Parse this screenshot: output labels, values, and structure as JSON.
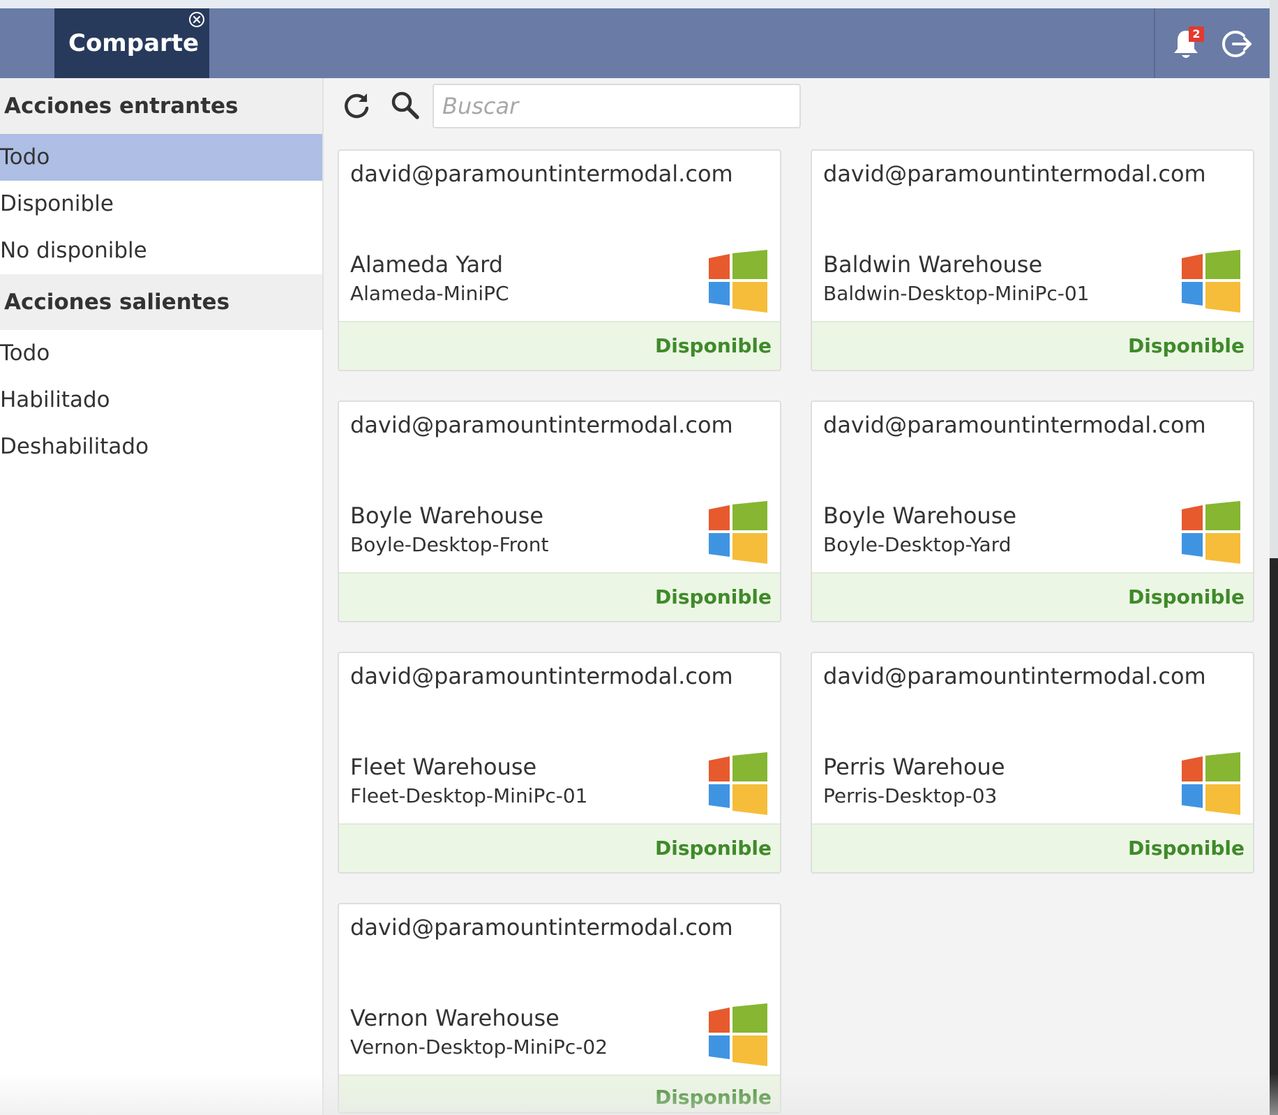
{
  "header": {
    "app_title": "Comparte",
    "notification_count": "2"
  },
  "sidebar": {
    "incoming": {
      "title": "Acciones entrantes",
      "items": [
        {
          "label": "Todo",
          "active": true
        },
        {
          "label": "Disponible",
          "active": false
        },
        {
          "label": "No disponible",
          "active": false
        }
      ]
    },
    "outgoing": {
      "title": "Acciones salientes",
      "items": [
        {
          "label": "Todo"
        },
        {
          "label": "Habilitado"
        },
        {
          "label": "Deshabilitado"
        }
      ]
    }
  },
  "toolbar": {
    "search_placeholder": "Buscar"
  },
  "cards": [
    {
      "email": "david@paramountintermodal.com",
      "name": "Alameda Yard",
      "host": "Alameda-MiniPC",
      "status": "Disponible",
      "os": "windows-icon"
    },
    {
      "email": "david@paramountintermodal.com",
      "name": "Baldwin Warehouse",
      "host": "Baldwin-Desktop-MiniPc-01",
      "status": "Disponible",
      "os": "windows-icon"
    },
    {
      "email": "david@paramountintermodal.com",
      "name": "Boyle Warehouse",
      "host": "Boyle-Desktop-Front",
      "status": "Disponible",
      "os": "windows-icon"
    },
    {
      "email": "david@paramountintermodal.com",
      "name": "Boyle Warehouse",
      "host": "Boyle-Desktop-Yard",
      "status": "Disponible",
      "os": "windows-icon"
    },
    {
      "email": "david@paramountintermodal.com",
      "name": "Fleet Warehouse",
      "host": "Fleet-Desktop-MiniPc-01",
      "status": "Disponible",
      "os": "windows-icon"
    },
    {
      "email": "david@paramountintermodal.com",
      "name": "Perris Warehoue",
      "host": "Perris-Desktop-03",
      "status": "Disponible",
      "os": "windows-icon"
    },
    {
      "email": "david@paramountintermodal.com",
      "name": "Vernon Warehouse",
      "host": "Vernon-Desktop-MiniPc-02",
      "status": "Disponible",
      "os": "windows-icon"
    }
  ],
  "colors": {
    "header": "#6a7ba6",
    "app_tab": "#283a5b",
    "active_nav": "#aebee4",
    "status_green": "#3f8a2a",
    "card_footer": "#ecf6e4",
    "badge": "#e23a2f"
  }
}
